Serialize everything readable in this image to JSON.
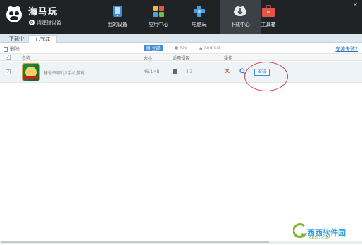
{
  "app": {
    "name": "海马玩",
    "connection_status": "请连接设备"
  },
  "nav": {
    "tabs": [
      {
        "label": "我的设备",
        "icon": "tablet-icon"
      },
      {
        "label": "应用中心",
        "icon": "apps-grid-icon"
      },
      {
        "label": "电脑玩",
        "icon": "gamepad-icon"
      },
      {
        "label": "下载中心",
        "icon": "cloud-download-icon",
        "active": true
      },
      {
        "label": "工具箱",
        "icon": "toolbox-icon"
      }
    ]
  },
  "subtabs": {
    "downloading": "下载中",
    "completed": "已完成"
  },
  "toolbar": {
    "delete_label": "删除",
    "filters": {
      "all": "全部",
      "ios": "IOS",
      "android": "Android"
    },
    "install_fail_link": "安装失败?"
  },
  "table": {
    "headers": {
      "name": "名称",
      "size": "大小",
      "device": "适用设备",
      "action": "操作"
    },
    "rows": [
      {
        "name": "爸爸去哪儿2手机游戏",
        "size": "46.1MB",
        "version": "4.3",
        "action_label": "安装"
      }
    ]
  },
  "watermark": {
    "text": "西西软件园",
    "sub": "CR173.COM"
  },
  "colors": {
    "header_bg": "#1f2326",
    "accent": "#3d8ed6",
    "highlight_circle": "#d8414a"
  }
}
